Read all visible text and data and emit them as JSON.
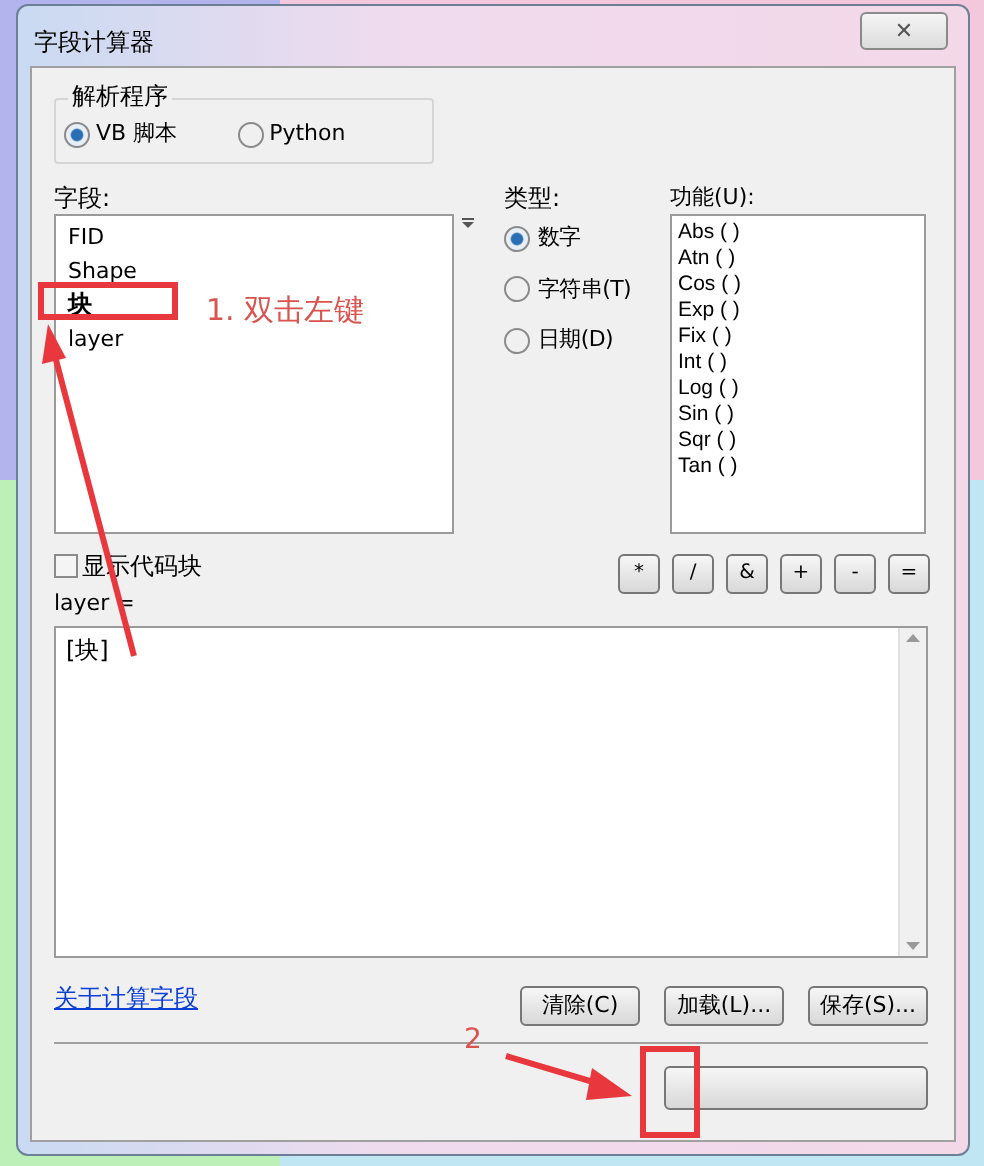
{
  "window": {
    "title": "字段计算器",
    "close": "✕"
  },
  "parser": {
    "title": "解析程序",
    "options": [
      {
        "label": "VB 脚本",
        "selected": true
      },
      {
        "label": "Python",
        "selected": false
      }
    ]
  },
  "fields": {
    "label": "字段:",
    "items": [
      {
        "label": "FID",
        "selected": false
      },
      {
        "label": "Shape",
        "selected": false
      },
      {
        "label": "块",
        "selected": true
      },
      {
        "label": "layer",
        "selected": false
      }
    ]
  },
  "type": {
    "label": "类型:",
    "options": [
      {
        "label": "数字",
        "selected": true
      },
      {
        "label": "字符串(T)",
        "selected": false
      },
      {
        "label": "日期(D)",
        "selected": false
      }
    ]
  },
  "functions": {
    "label": "功能(U):",
    "items": [
      "Abs ( )",
      "Atn ( )",
      "Cos ( )",
      "Exp ( )",
      "Fix ( )",
      "Int ( )",
      "Log ( )",
      "Sin ( )",
      "Sqr ( )",
      "Tan ( )"
    ]
  },
  "show_codeblock": {
    "label": "显示代码块",
    "checked": false
  },
  "operators": [
    "*",
    "/",
    "&",
    "+",
    "-",
    "="
  ],
  "expression": {
    "label": "layer =",
    "value": "[块]"
  },
  "help_link": "关于计算字段",
  "buttons": [
    "清除(C)",
    "加载(L)...",
    "保存(S)..."
  ],
  "annotations": [
    {
      "kind": "box_note",
      "text": "1. 双击左键"
    },
    {
      "kind": "arrow_note",
      "text": "2"
    }
  ]
}
